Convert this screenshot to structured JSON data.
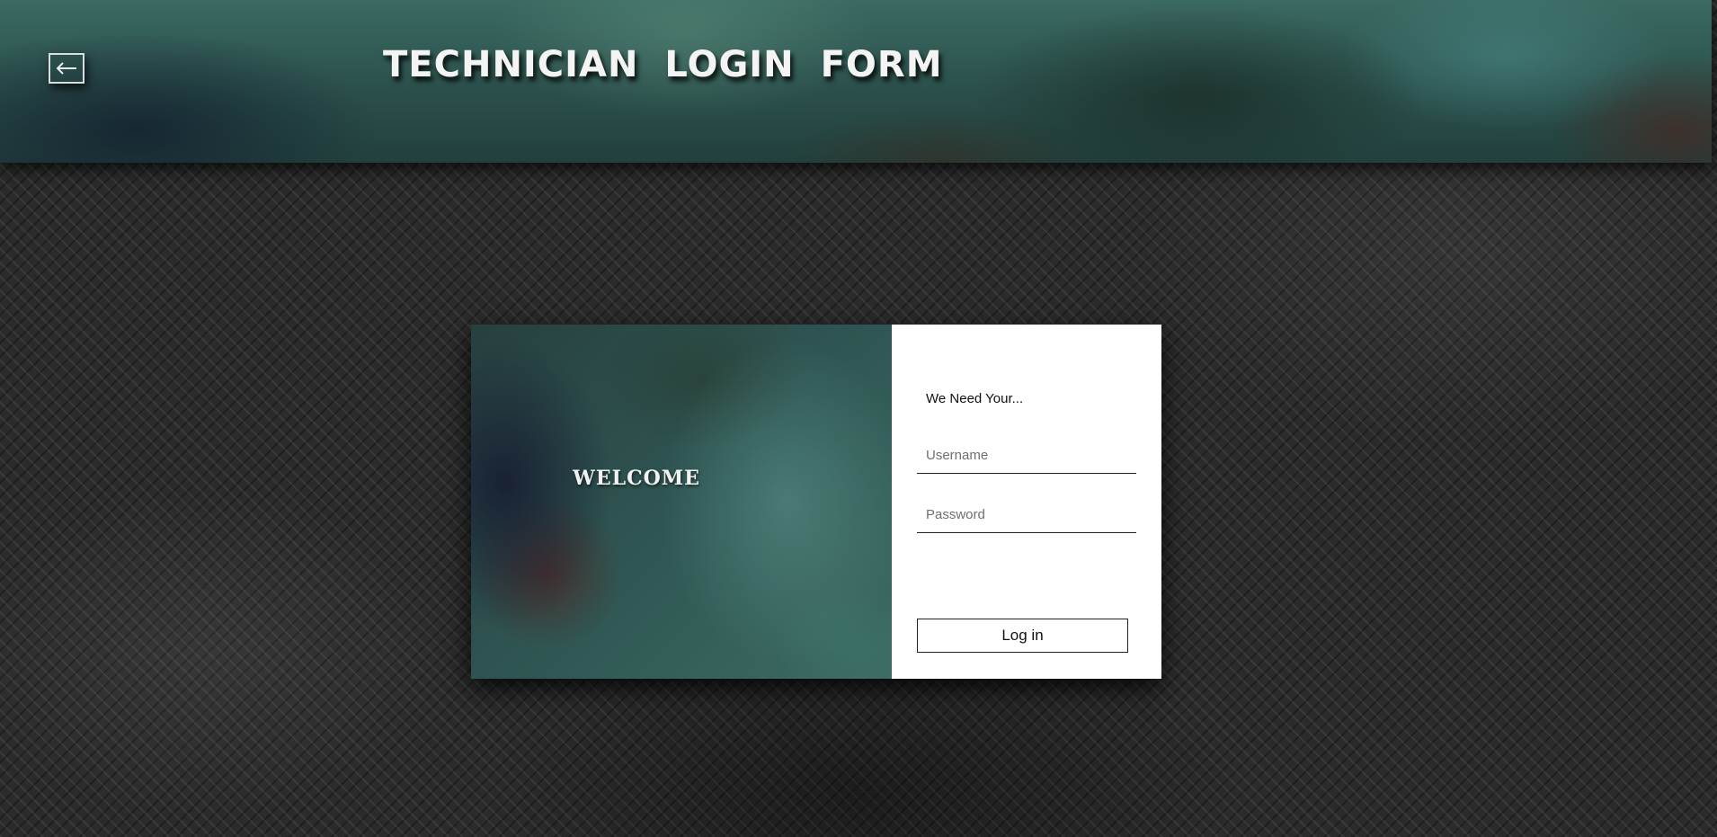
{
  "header": {
    "back_icon": "left-arrow-icon",
    "title": "TECHNICIAN LOGIN FORM"
  },
  "card": {
    "welcome_text": "WELCOME",
    "form": {
      "heading": "We Need Your...",
      "username": {
        "value": "",
        "placeholder": "Username"
      },
      "password": {
        "value": "",
        "placeholder": "Password"
      },
      "submit_label": "Log in"
    }
  },
  "colors": {
    "banner_teal": "#2c5450",
    "page_background": "#2b2b2b",
    "form_background": "#ffffff",
    "title_text": "#f4f4f4"
  }
}
